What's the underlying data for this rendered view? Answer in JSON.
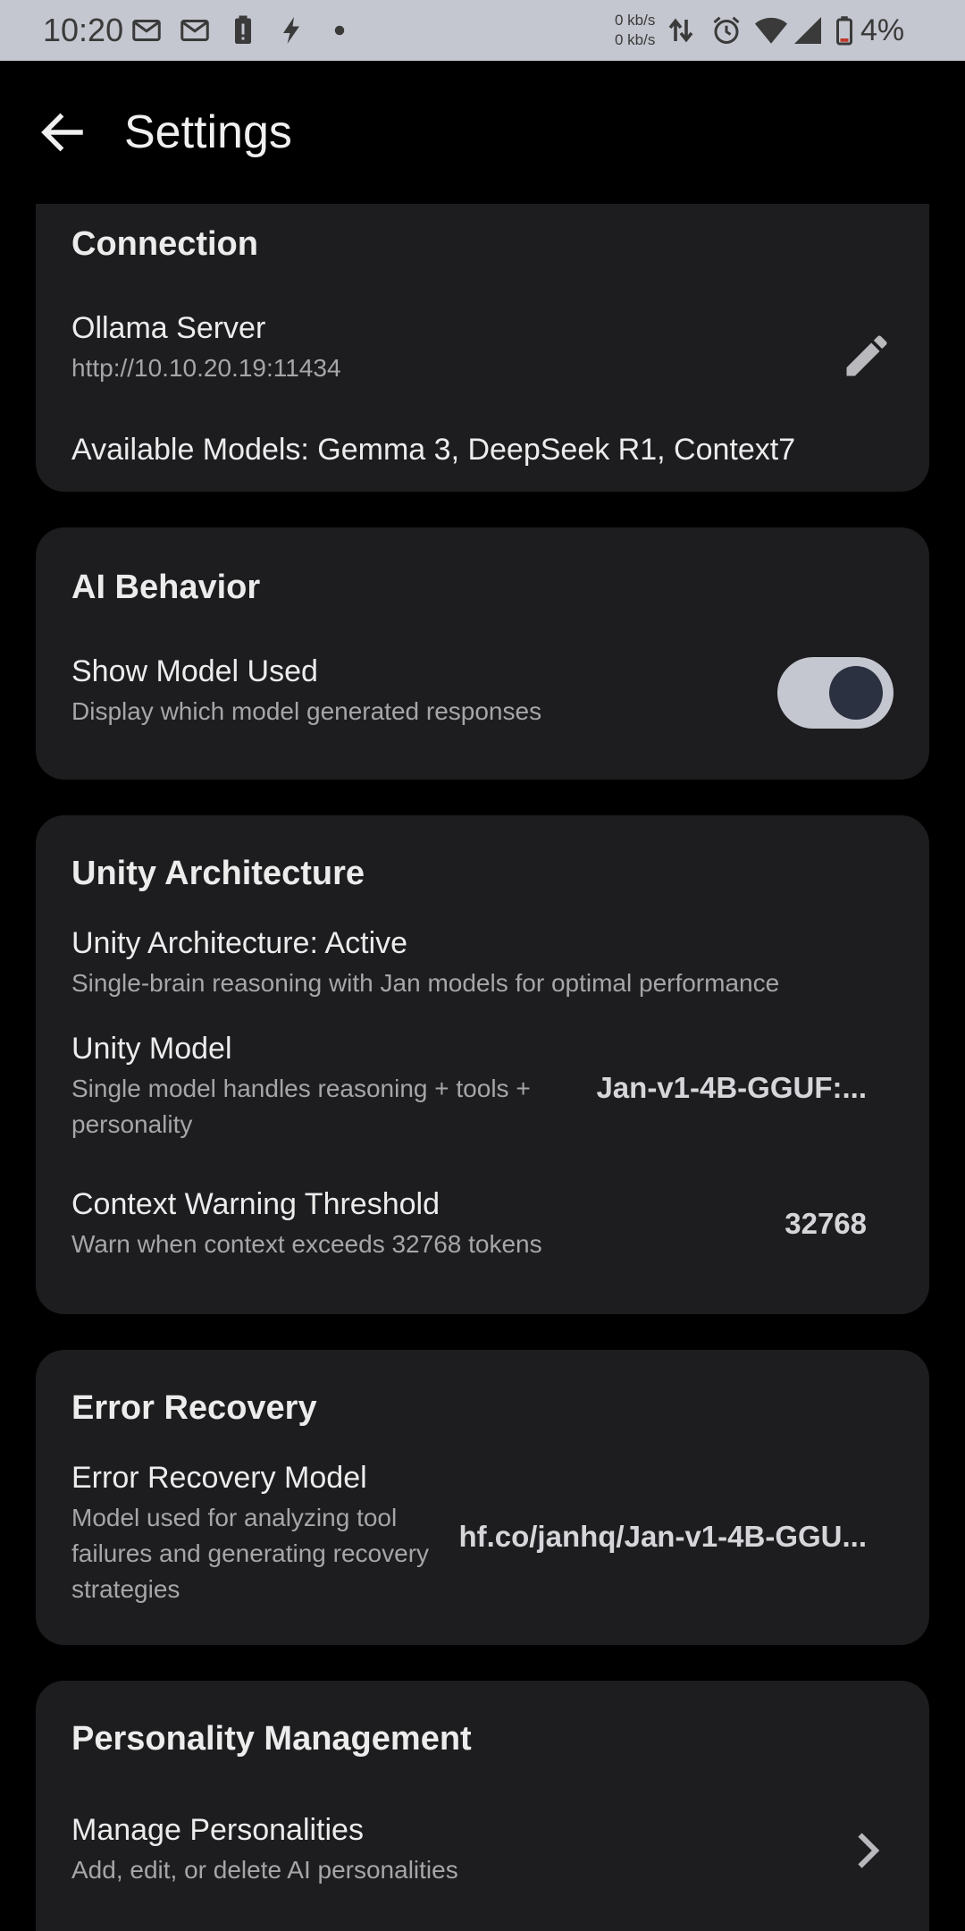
{
  "status_bar": {
    "time": "10:20",
    "net_up": "0 kb/s",
    "net_down": "0 kb/s",
    "battery": "4%",
    "icons": [
      "mail-icon",
      "mail-icon",
      "battery-alert-icon",
      "flash-icon",
      "dot-icon",
      "data-arrows-icon",
      "alarm-icon",
      "wifi-icon",
      "signal-icon",
      "battery-icon"
    ]
  },
  "app_bar": {
    "title": "Settings",
    "back_icon": "arrow-back-icon"
  },
  "connection": {
    "title": "Connection",
    "server_label": "Ollama Server",
    "server_url": "http://10.10.20.19:11434",
    "edit_icon": "pencil-icon",
    "models_text": "Available Models: Gemma 3, DeepSeek R1, Context7"
  },
  "ai_behavior": {
    "title": "AI Behavior",
    "show_model_label": "Show Model Used",
    "show_model_desc": "Display which model generated responses",
    "show_model_enabled": true
  },
  "unity": {
    "title": "Unity Architecture",
    "status_label": "Unity Architecture: Active",
    "status_desc": "Single-brain reasoning with Jan models for optimal performance",
    "model_label": "Unity Model",
    "model_desc": "Single model handles reasoning + tools + personality",
    "model_value": "Jan-v1-4B-GGUF:...",
    "threshold_label": "Context Warning Threshold",
    "threshold_desc": "Warn when context exceeds 32768 tokens",
    "threshold_value": "32768"
  },
  "error_recovery": {
    "title": "Error Recovery",
    "model_label": "Error Recovery Model",
    "model_desc": "Model used for analyzing tool failures and generating recovery strategies",
    "model_value": "hf.co/janhq/Jan-v1-4B-GGU..."
  },
  "personality": {
    "title": "Personality Management",
    "manage_label": "Manage Personalities",
    "manage_desc": "Add, edit, or delete AI personalities",
    "chevron_icon": "chevron-right-icon"
  },
  "colors": {
    "background": "#000000",
    "card": "#1d1d1f",
    "status_bar": "#c5c7d0",
    "toggle_track": "#c4c6d0",
    "toggle_knob": "#2b3140"
  }
}
